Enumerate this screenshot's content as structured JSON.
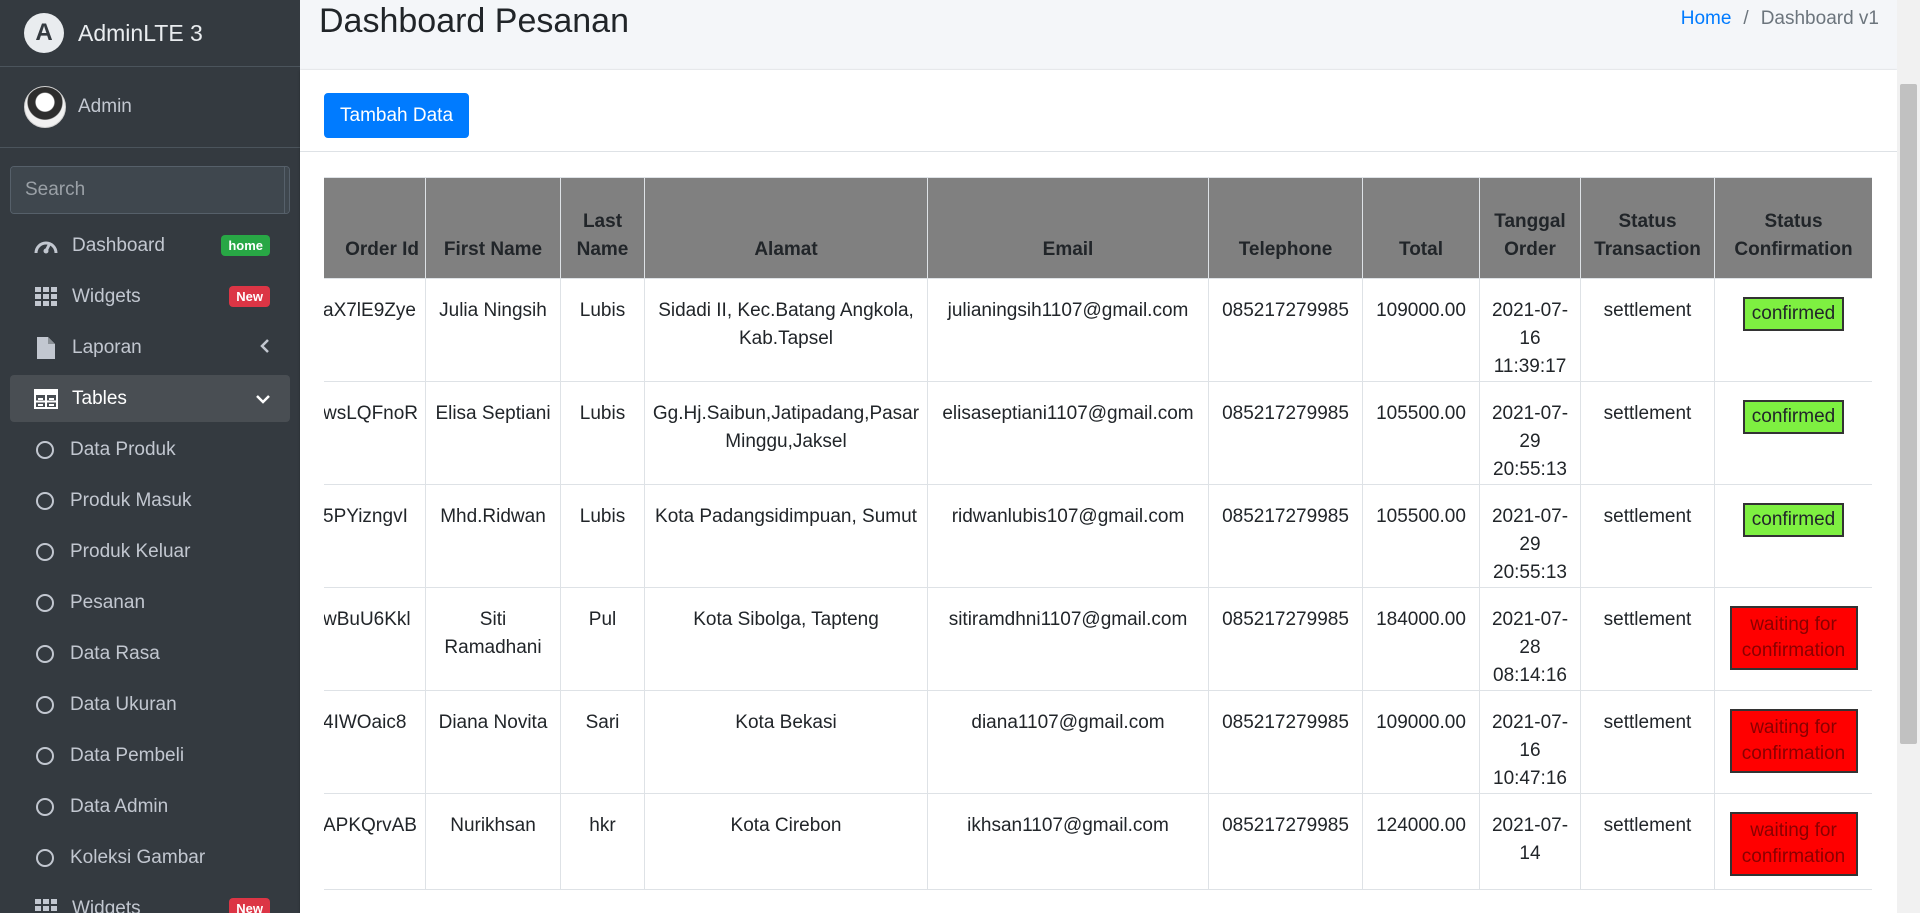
{
  "brand": {
    "name": "AdminLTE 3",
    "logo_letter": "A"
  },
  "user": {
    "name": "Admin"
  },
  "search": {
    "placeholder": "Search"
  },
  "nav": {
    "dashboard": {
      "label": "Dashboard",
      "badge": "home"
    },
    "widgets": {
      "label": "Widgets",
      "badge": "New"
    },
    "laporan": {
      "label": "Laporan"
    },
    "tables": {
      "label": "Tables"
    },
    "sub": [
      "Data Produk",
      "Produk Masuk",
      "Produk Keluar",
      "Pesanan",
      "Data Rasa",
      "Data Ukuran",
      "Data Pembeli",
      "Data Admin",
      "Koleksi Gambar"
    ],
    "widgets2": {
      "label": "Widgets",
      "badge": "New"
    }
  },
  "header": {
    "title": "Dashboard Pesanan"
  },
  "breadcrumb": {
    "home": "Home",
    "sep": "/",
    "current": "Dashboard v1"
  },
  "toolbar": {
    "add_label": "Tambah Data"
  },
  "table": {
    "columns": [
      "Order Id",
      "First Name",
      "Last Name",
      "Alamat",
      "Email",
      "Telephone",
      "Total",
      "Tanggal Order",
      "Status Transaction",
      "Status Confirmation"
    ],
    "rows": [
      [
        "aX7lE9Zye",
        "Julia Ningsih",
        "Lubis",
        "Sidadi II, Kec.Batang Angkola, Kab.Tapsel",
        "julianingsih1107@gmail.com",
        "085217279985",
        "109000.00",
        "2021-07-16 11:39:17",
        "settlement",
        "confirmed"
      ],
      [
        "wsLQFnoR",
        "Elisa Septiani",
        "Lubis",
        "Gg.Hj.Saibun,Jatipadang,Pasar Minggu,Jaksel",
        "elisaseptiani1107@gmail.com",
        "085217279985",
        "105500.00",
        "2021-07-29 20:55:13",
        "settlement",
        "confirmed"
      ],
      [
        "5PYizngvI",
        "Mhd.Ridwan",
        "Lubis",
        "Kota Padangsidimpuan, Sumut",
        "ridwanlubis107@gmail.com",
        "085217279985",
        "105500.00",
        "2021-07-29 20:55:13",
        "settlement",
        "confirmed"
      ],
      [
        "wBuU6Kkl",
        "Siti Ramadhani",
        "Pul",
        "Kota Sibolga, Tapteng",
        "sitiramdhni1107@gmail.com",
        "085217279985",
        "184000.00",
        "2021-07-28 08:14:16",
        "settlement",
        "waiting for confirmation"
      ],
      [
        "4IWOaic8",
        "Diana Novita",
        "Sari",
        "Kota Bekasi",
        "diana1107@gmail.com",
        "085217279985",
        "109000.00",
        "2021-07-16 10:47:16",
        "settlement",
        "waiting for confirmation"
      ],
      [
        "APKQrvAB",
        "Nurikhsan",
        "hkr",
        "Kota Cirebon",
        "ikhsan1107@gmail.com",
        "085217279985",
        "124000.00",
        "2021-07-14",
        "settlement",
        "waiting for confirmation"
      ]
    ]
  },
  "colors": {
    "sidebar": "#343a40",
    "primary": "#007bff",
    "confirmed": "#7ef041",
    "waiting": "#ff0000"
  }
}
